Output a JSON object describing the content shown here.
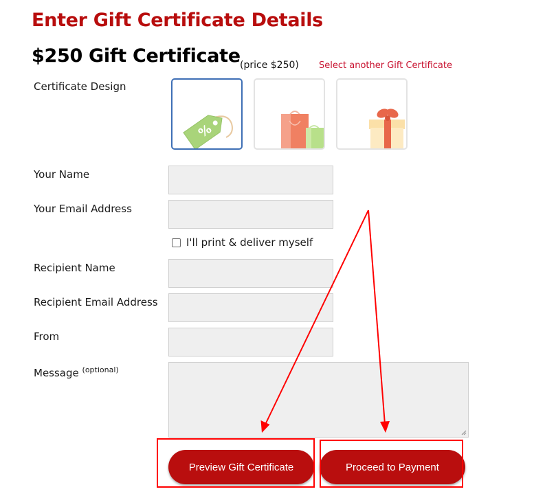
{
  "heading": "Enter Gift Certificate Details",
  "product": {
    "title": "$250 Gift Certificate",
    "price": "(price $250)",
    "select_another": "Select another Gift Certificate"
  },
  "design_picker": {
    "label": "Certificate Design",
    "options": [
      {
        "icon": "price-tag-icon",
        "selected": true
      },
      {
        "icon": "shopping-bags-icon",
        "selected": false
      },
      {
        "icon": "gift-box-icon",
        "selected": false
      }
    ]
  },
  "form": {
    "your_name": {
      "label": "Your Name",
      "value": ""
    },
    "your_email": {
      "label": "Your Email Address",
      "value": ""
    },
    "print_myself": {
      "label": "I'll print & deliver myself",
      "checked": false
    },
    "recipient_name": {
      "label": "Recipient Name",
      "value": ""
    },
    "recipient_email": {
      "label": "Recipient Email Address",
      "value": ""
    },
    "from": {
      "label": "From",
      "value": ""
    },
    "message": {
      "label": "Message",
      "optional": "(optional)",
      "value": ""
    }
  },
  "buttons": {
    "preview": "Preview Gift Certificate",
    "proceed": "Proceed to Payment"
  },
  "colors": {
    "accent": "#b80d0d",
    "link": "#c8102e",
    "annotation": "#ff0000",
    "selected_border": "#3e6fb5",
    "field_bg": "#efefef"
  }
}
